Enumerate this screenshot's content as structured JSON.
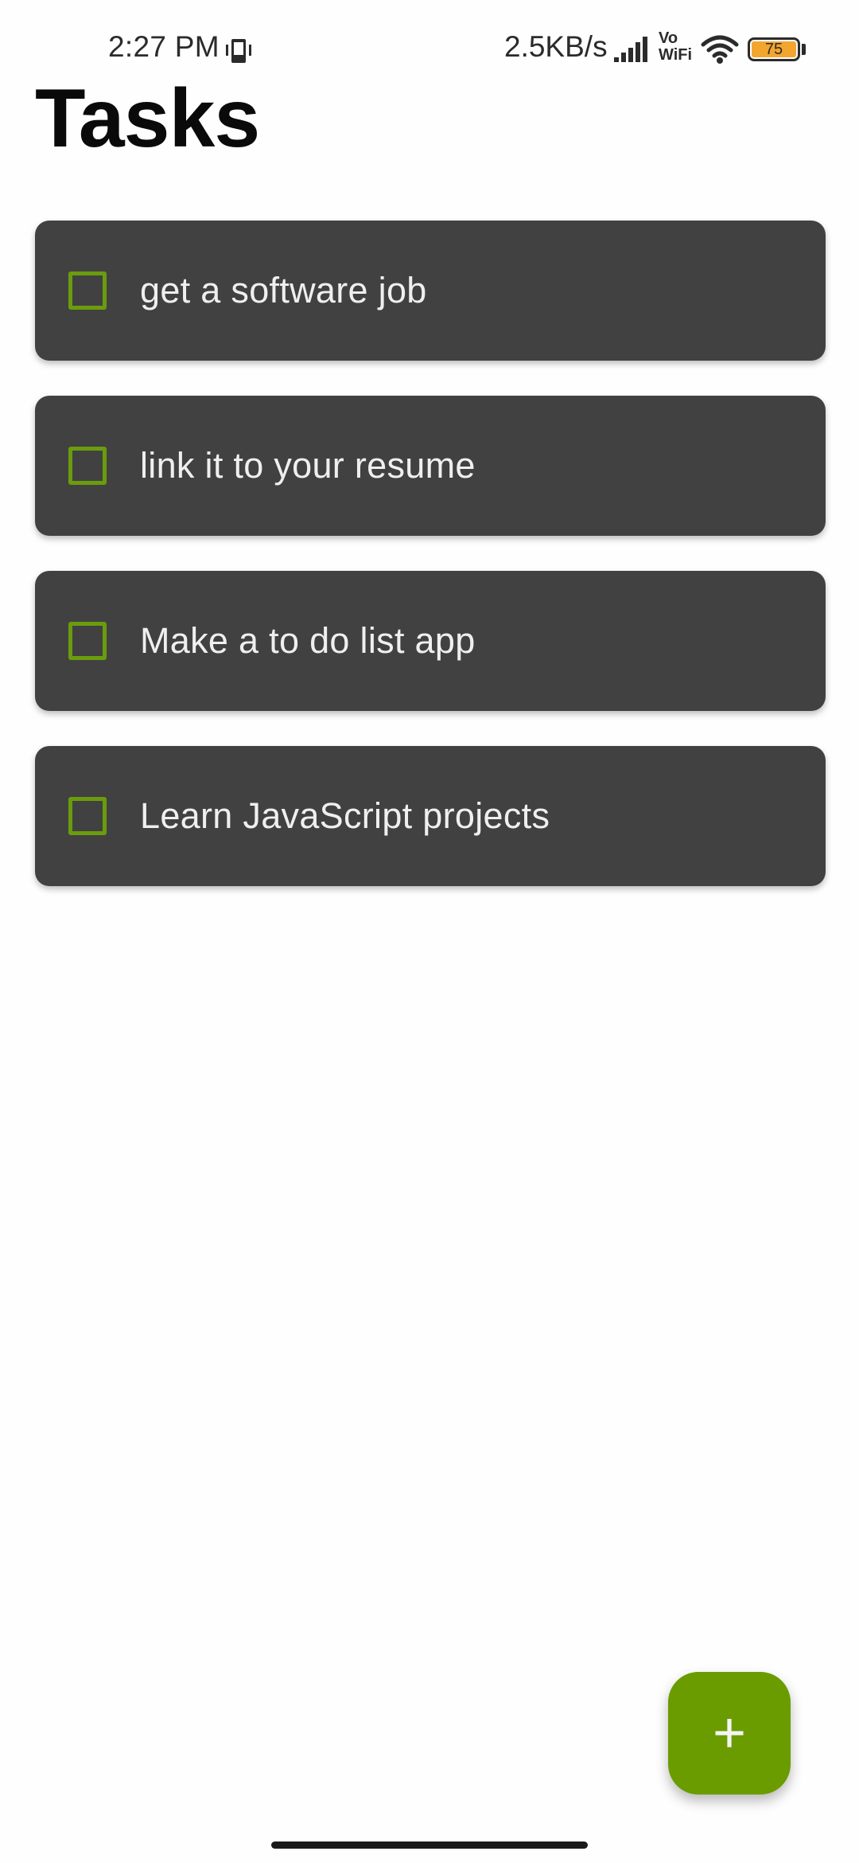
{
  "status_bar": {
    "time": "2:27 PM",
    "net_speed": "2.5KB/s",
    "vowifi": "Vo\nWiFi",
    "battery_level": "75",
    "icons": [
      "phone-vibrate-icon",
      "cell-signal-icon",
      "wifi-icon",
      "battery-icon"
    ],
    "battery_color": "#f2a62e"
  },
  "page": {
    "title": "Tasks"
  },
  "tasks": [
    {
      "label": "get a software job",
      "checked": false
    },
    {
      "label": "link it to your resume",
      "checked": false
    },
    {
      "label": "Make a to do list app",
      "checked": false
    },
    {
      "label": "Learn JavaScript projects",
      "checked": false
    }
  ],
  "fab": {
    "icon": "plus-icon",
    "symbol": "+"
  },
  "colors": {
    "accent": "#6a9c00",
    "card_background": "#414141",
    "card_text": "#efefef",
    "page_background": "#fefefe"
  }
}
